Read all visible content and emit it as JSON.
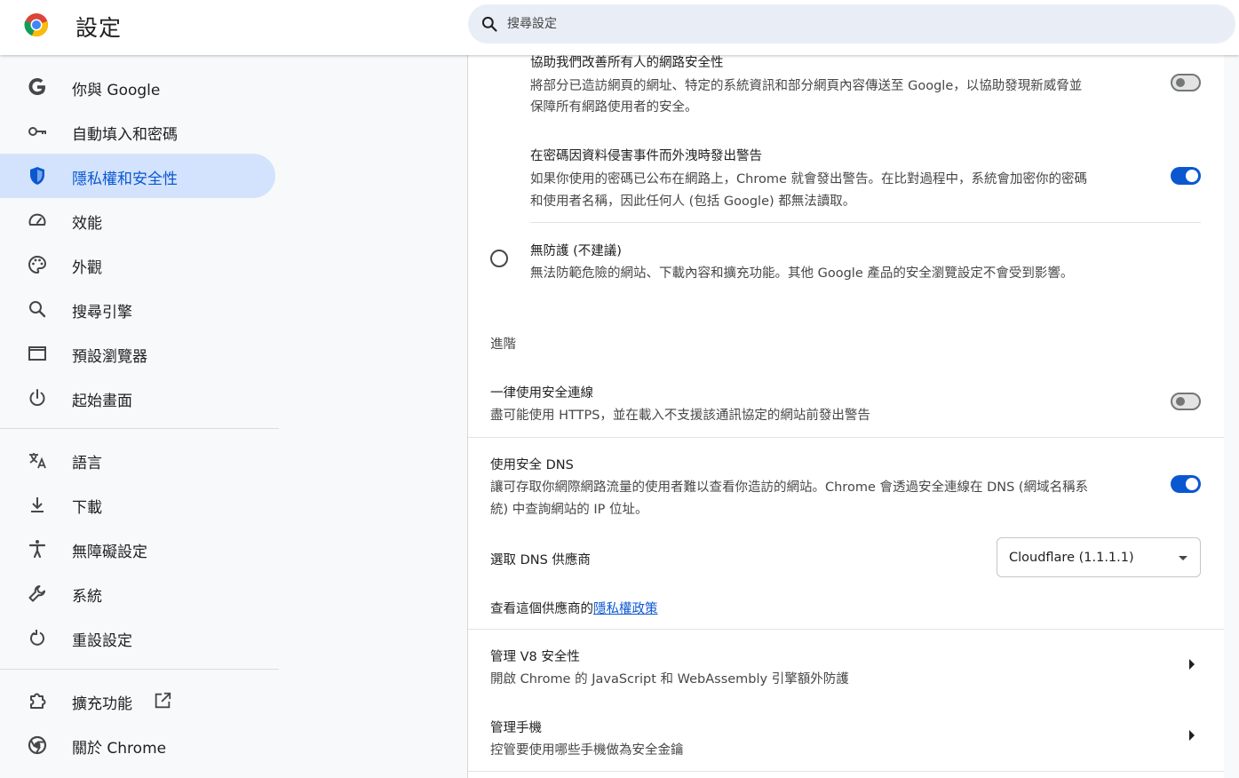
{
  "header": {
    "title": "設定",
    "search_placeholder": "搜尋設定",
    "logo_icon": "chrome-logo-icon",
    "search_icon": "search-icon"
  },
  "sidebar": {
    "items": [
      {
        "label": "你與 Google",
        "icon": "google-g-icon"
      },
      {
        "label": "自動填入和密碼",
        "icon": "key-icon"
      },
      {
        "label": "隱私權和安全性",
        "icon": "shield-icon",
        "active": true
      },
      {
        "label": "效能",
        "icon": "speedometer-icon"
      },
      {
        "label": "外觀",
        "icon": "palette-icon"
      },
      {
        "label": "搜尋引擎",
        "icon": "search-icon"
      },
      {
        "label": "預設瀏覽器",
        "icon": "browser-window-icon"
      },
      {
        "label": "起始畫面",
        "icon": "power-icon"
      },
      {
        "label": "語言",
        "icon": "translate-icon"
      },
      {
        "label": "下載",
        "icon": "download-icon"
      },
      {
        "label": "無障礙設定",
        "icon": "accessibility-icon"
      },
      {
        "label": "系統",
        "icon": "wrench-icon"
      },
      {
        "label": "重設設定",
        "icon": "reset-icon"
      },
      {
        "label": "擴充功能",
        "icon": "puzzle-icon"
      },
      {
        "label": "關於 Chrome",
        "icon": "chrome-icon"
      }
    ],
    "external_link_icon": "open-in-new-icon"
  },
  "main": {
    "help_improve": {
      "title": "協助我們改善所有人的網路安全性",
      "desc_line1": "將部分已造訪網頁的網址、特定的系統資訊和部分網頁內容傳送至 Google，以協助發現新威脅並",
      "desc_line2": "保障所有網路使用者的安全。",
      "enabled": false
    },
    "password_leak": {
      "title": "在密碼因資料侵害事件而外洩時發出警告",
      "desc_line1": "如果你使用的密碼已公布在網路上，Chrome 就會發出警告。在比對過程中，系統會加密你的密碼",
      "desc_line2": "和使用者名稱，因此任何人 (包括 Google) 都無法讀取。",
      "enabled": true
    },
    "no_protection": {
      "title": "無防護 (不建議)",
      "desc": "無法防範危險的網站、下載內容和擴充功能。其他 Google 產品的安全瀏覽設定不會受到影響。",
      "selected": false
    },
    "advanced_heading": "進階",
    "https_first": {
      "title": "一律使用安全連線",
      "desc": "盡可能使用 HTTPS，並在載入不支援該通訊協定的網站前發出警告",
      "enabled": false
    },
    "secure_dns": {
      "title": "使用安全 DNS",
      "desc_line1": "讓可存取你網際網路流量的使用者難以查看你造訪的網站。Chrome 會透過安全連線在 DNS (網域名稱系",
      "desc_line2": "統) 中查詢網站的 IP 位址。",
      "enabled": true
    },
    "dns_provider": {
      "label": "選取 DNS 供應商",
      "selected": "Cloudflare (1.1.1.1)"
    },
    "provider_policy": {
      "prefix": "查看這個供應商的",
      "link": "隱私權政策"
    },
    "v8_security": {
      "title": "管理 V8 安全性",
      "desc": "開啟 Chrome 的 JavaScript 和 WebAssembly 引擎額外防護"
    },
    "manage_phones": {
      "title": "管理手機",
      "desc": "控管要使用哪些手機做為安全金鑰"
    }
  },
  "colors": {
    "accent": "#0b57d0",
    "active_nav_bg": "#d3e3fd",
    "search_bg": "#e9eef6"
  }
}
